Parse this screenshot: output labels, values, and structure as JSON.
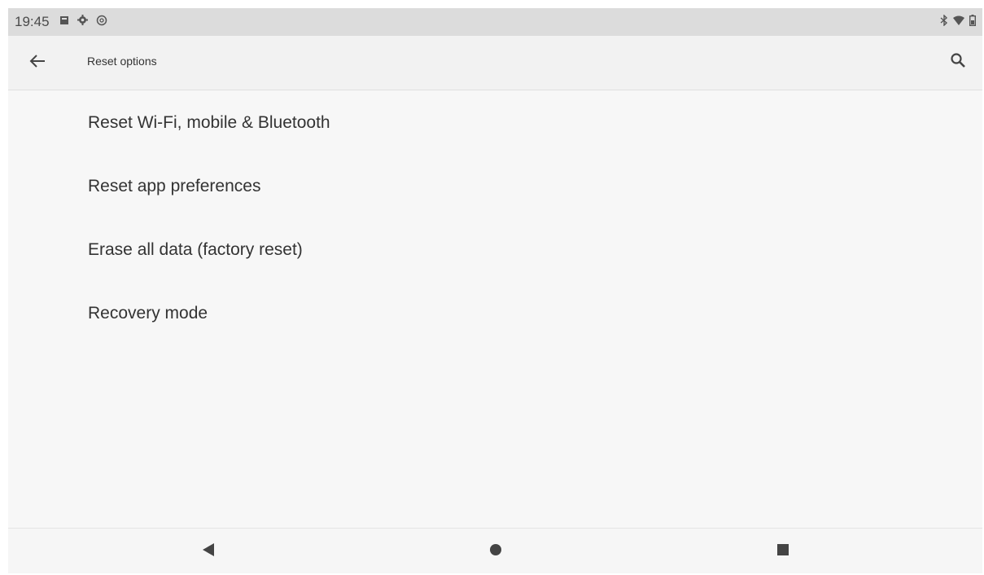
{
  "status_bar": {
    "time": "19:45",
    "left_icons": [
      "image-icon",
      "gear-icon",
      "at-sign-icon"
    ],
    "right_icons": [
      "bluetooth-icon",
      "wifi-icon",
      "battery-icon"
    ]
  },
  "app_bar": {
    "title": "Reset options",
    "back_icon": "arrow-back-icon",
    "search_icon": "search-icon"
  },
  "items": [
    {
      "label": "Reset Wi-Fi, mobile & Bluetooth"
    },
    {
      "label": "Reset app preferences"
    },
    {
      "label": "Erase all data (factory reset)"
    },
    {
      "label": "Recovery mode"
    }
  ],
  "nav_bar": {
    "buttons": [
      "back-triangle-icon",
      "home-circle-icon",
      "recents-square-icon"
    ]
  },
  "colors": {
    "status_bar_bg": "#dcdcdc",
    "app_bar_bg": "#f2f2f2",
    "content_bg": "#f7f7f7",
    "text": "#333333",
    "icon": "#555555"
  }
}
